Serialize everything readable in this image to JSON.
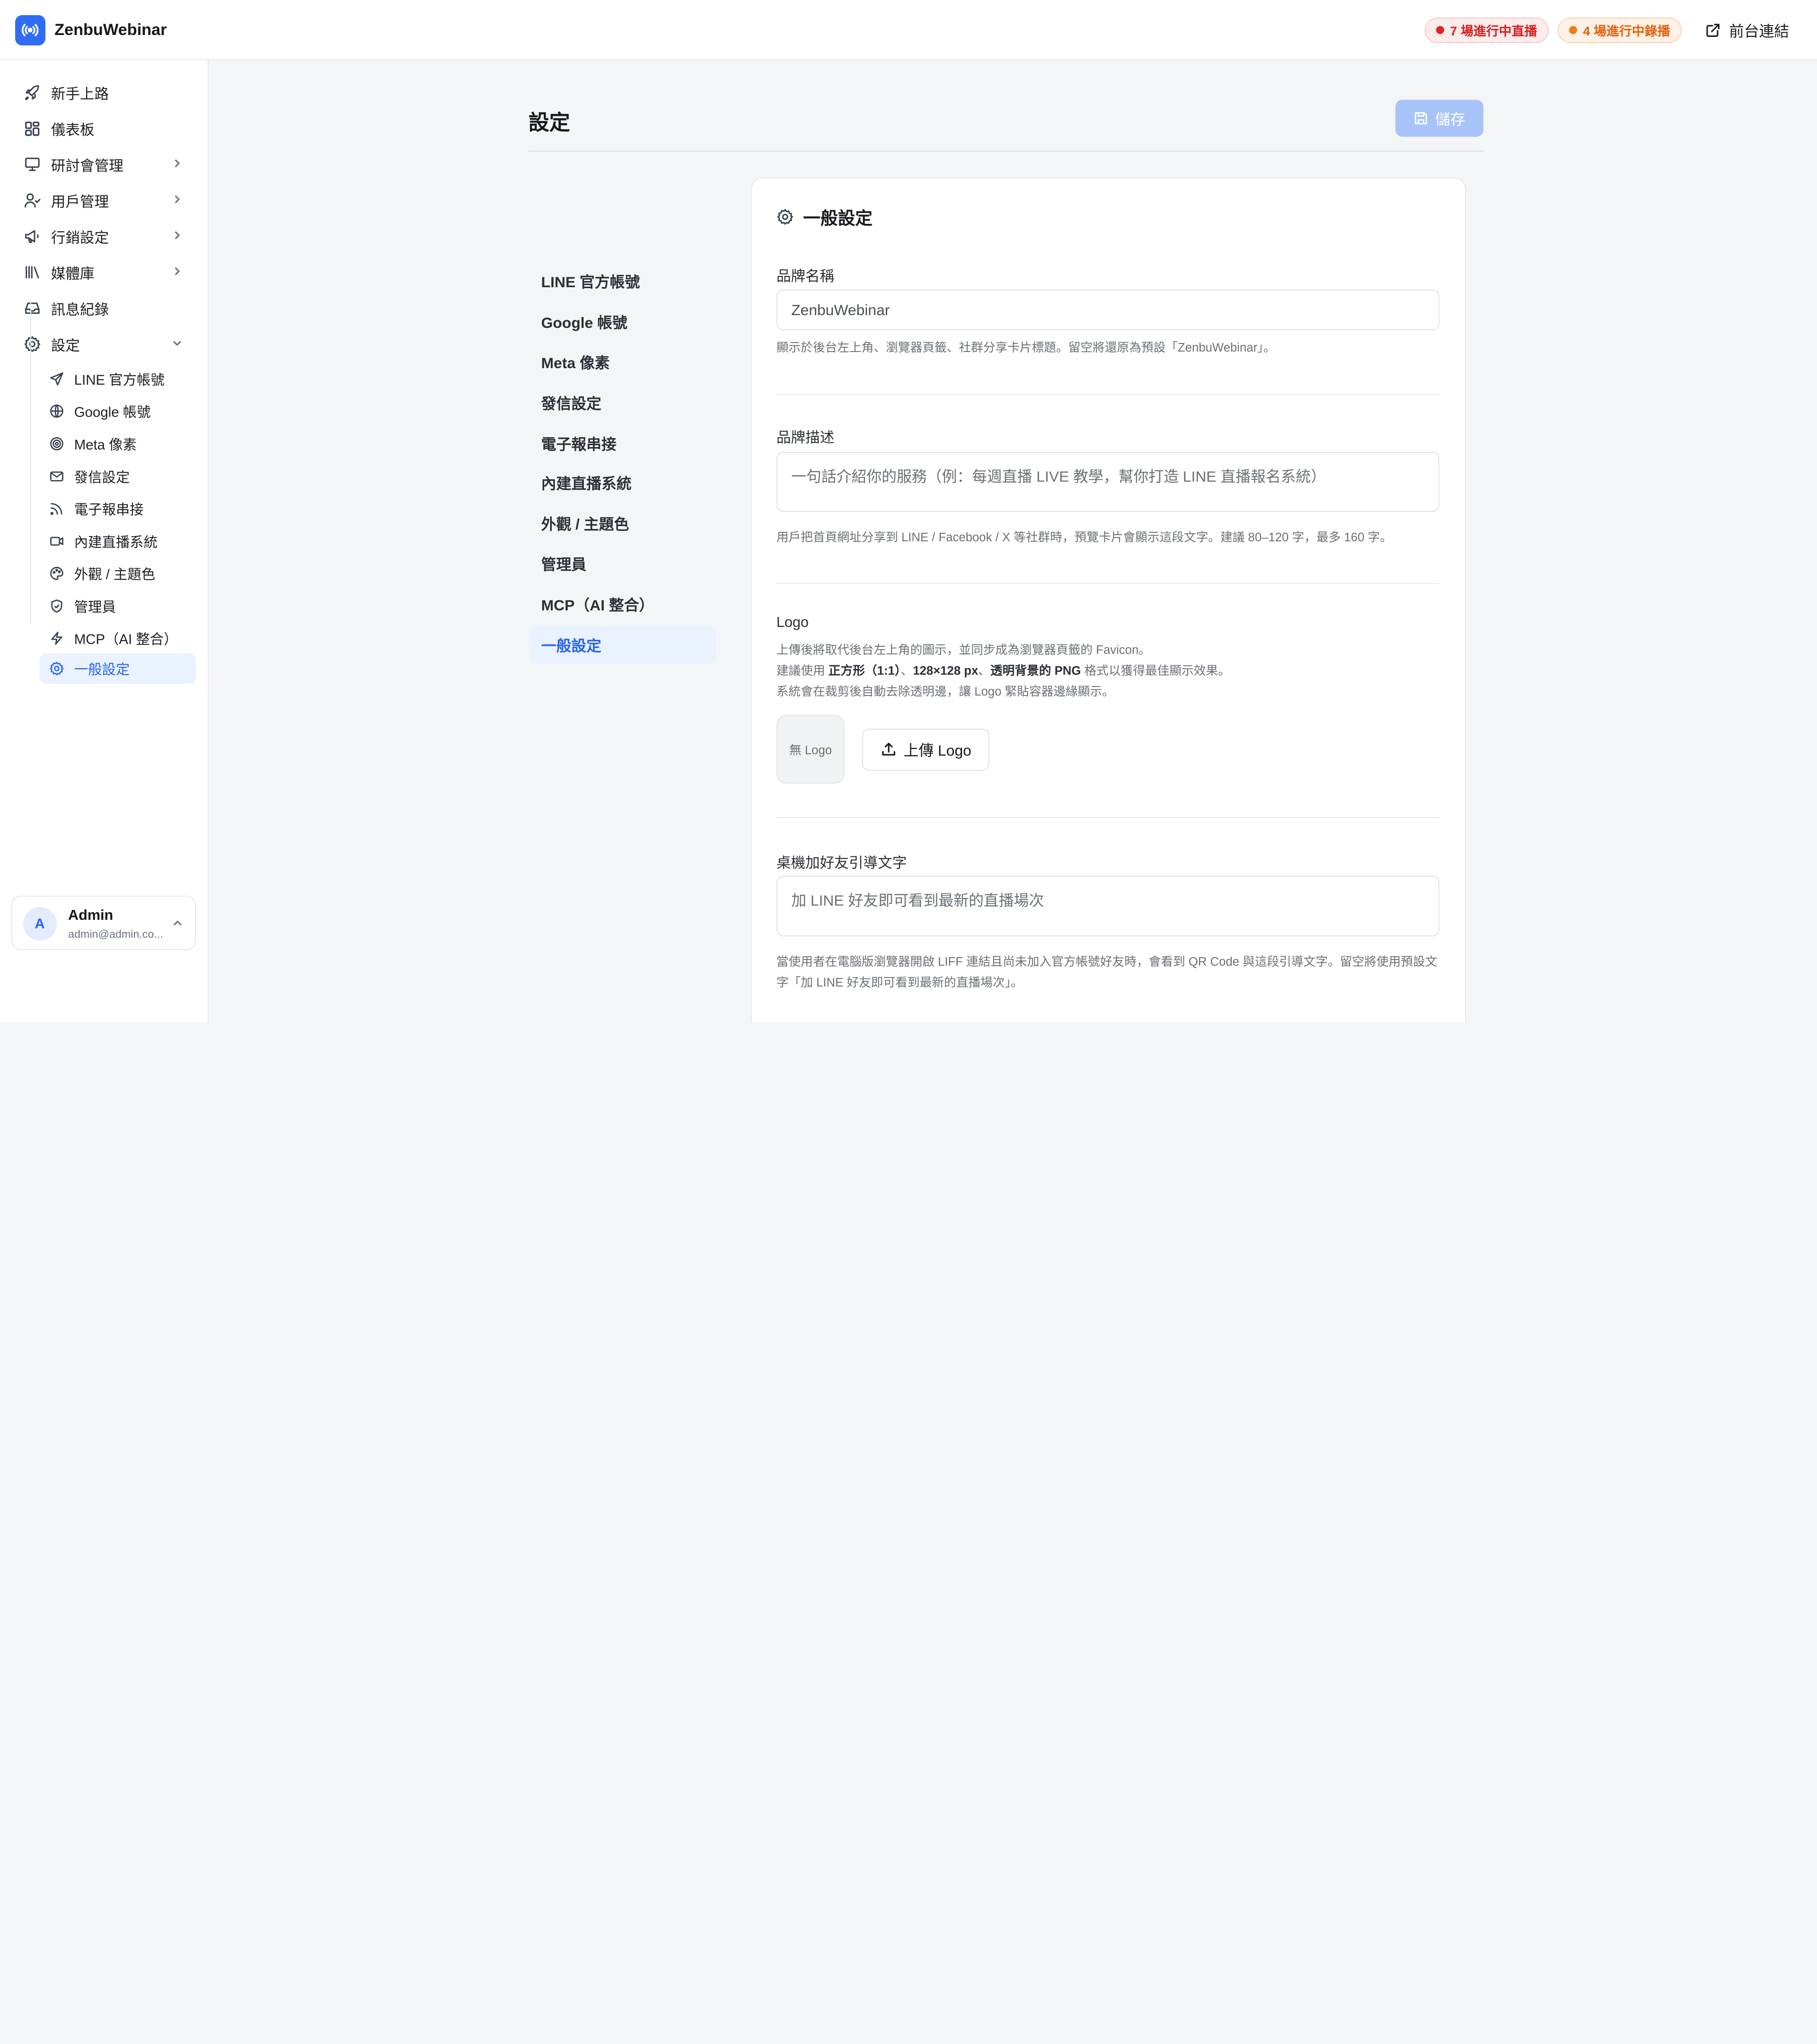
{
  "app": {
    "name": "ZenbuWebinar"
  },
  "topbar": {
    "live_badge": "7 場進行中直播",
    "recording_badge": "4 場進行中錄播",
    "frontend_link": "前台連結"
  },
  "sidebar": {
    "items": [
      {
        "label": "新手上路",
        "icon": "rocket-icon"
      },
      {
        "label": "儀表板",
        "icon": "dashboard-icon"
      },
      {
        "label": "研討會管理",
        "icon": "presentation-icon"
      },
      {
        "label": "用戶管理",
        "icon": "users-icon"
      },
      {
        "label": "行銷設定",
        "icon": "megaphone-icon"
      },
      {
        "label": "媒體庫",
        "icon": "library-icon"
      },
      {
        "label": "訊息紀錄",
        "icon": "inbox-icon"
      },
      {
        "label": "設定",
        "icon": "gear-icon"
      }
    ],
    "sub_items": [
      {
        "label": "LINE 官方帳號",
        "icon": "send-icon"
      },
      {
        "label": "Google 帳號",
        "icon": "globe-icon"
      },
      {
        "label": "Meta 像素",
        "icon": "target-icon"
      },
      {
        "label": "發信設定",
        "icon": "mail-icon"
      },
      {
        "label": "電子報串接",
        "icon": "rss-icon"
      },
      {
        "label": "內建直播系統",
        "icon": "video-icon"
      },
      {
        "label": "外觀 / 主題色",
        "icon": "palette-icon"
      },
      {
        "label": "管理員",
        "icon": "shield-icon"
      },
      {
        "label": "MCP（AI 整合）",
        "icon": "bolt-icon"
      },
      {
        "label": "一般設定",
        "icon": "gear-icon"
      }
    ],
    "user": {
      "initial": "A",
      "name": "Admin",
      "email": "admin@admin.co..."
    }
  },
  "page": {
    "title": "設定",
    "save_label": "儲存"
  },
  "settings_nav": [
    "LINE 官方帳號",
    "Google 帳號",
    "Meta 像素",
    "發信設定",
    "電子報串接",
    "內建直播系統",
    "外觀 / 主題色",
    "管理員",
    "MCP（AI 整合）",
    "一般設定"
  ],
  "general": {
    "title": "一般設定",
    "brand_name": {
      "label": "品牌名稱",
      "value": "ZenbuWebinar",
      "hint": "顯示於後台左上角、瀏覽器頁籤、社群分享卡片標題。留空將還原為預設「ZenbuWebinar」。"
    },
    "brand_desc": {
      "label": "品牌描述",
      "placeholder": "一句話介紹你的服務（例：每週直播 LIVE 教學，幫你打造 LINE 直播報名系統）",
      "hint": "用戶把首頁網址分享到 LINE / Facebook / X 等社群時，預覽卡片會顯示這段文字。建議 80–120 字，最多 160 字。"
    },
    "logo": {
      "label": "Logo",
      "hint1": "上傳後將取代後台左上角的圖示，並同步成為瀏覽器頁籤的 Favicon。",
      "hint2_pre": "建議使用 ",
      "hint2_b1": "正方形（1:1）",
      "hint2_sep1": "、",
      "hint2_b2": "128×128 px",
      "hint2_sep2": "、",
      "hint2_b3": "透明背景的 PNG",
      "hint2_post": " 格式以獲得最佳顯示效果。",
      "hint3": "系統會在裁剪後自動去除透明邊，讓 Logo 緊貼容器邊緣顯示。",
      "empty_text": "無 Logo",
      "upload_label": "上傳 Logo"
    },
    "desktop_friend": {
      "label": "桌機加好友引導文字",
      "placeholder": "加 LINE 好友即可看到最新的直播場次",
      "hint": "當使用者在電腦版瀏覽器開啟 LIFF 連結且尚未加入官方帳號好友時，會看到 QR Code 與這段引導文字。留空將使用預設文字「加 LINE 好友即可看到最新的直播場次」。"
    }
  },
  "colors": {
    "accent": "#2563eb",
    "brand": "#2f6df6",
    "live": "#e02424",
    "recording": "#f07a14"
  }
}
